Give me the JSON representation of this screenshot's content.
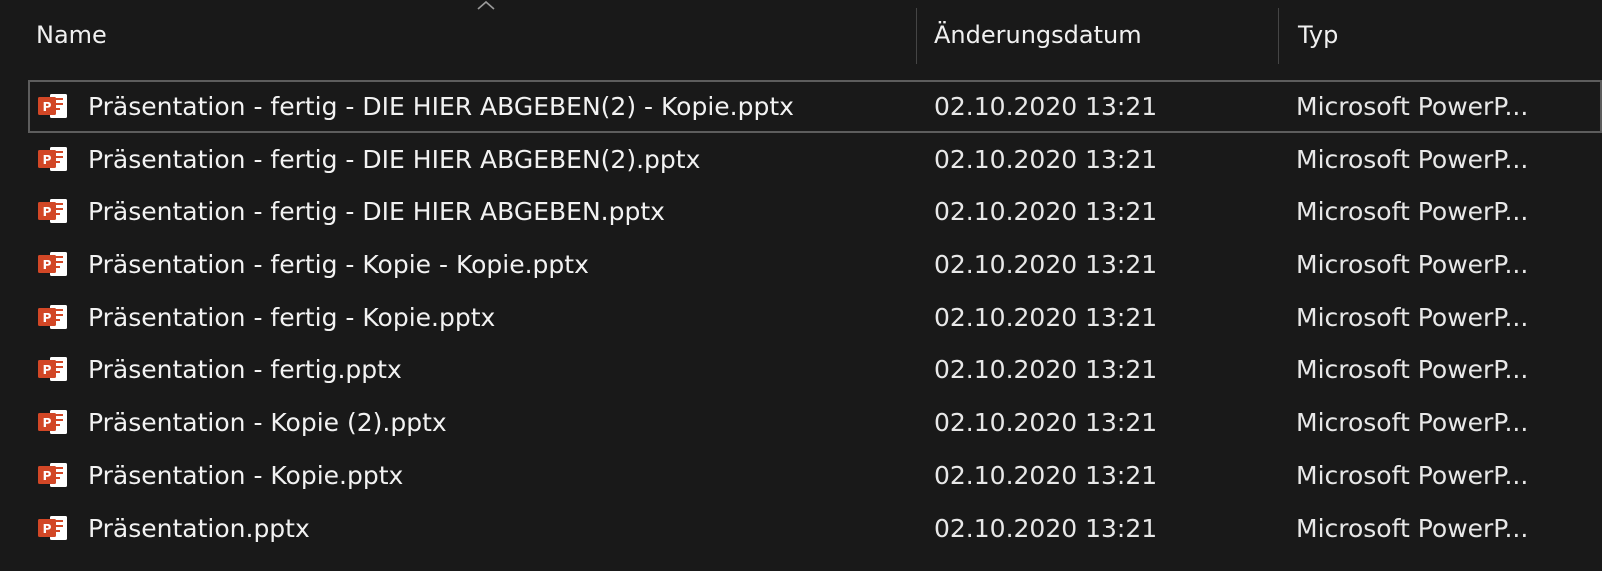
{
  "columns": {
    "name": "Name",
    "date": "Änderungsdatum",
    "type": "Typ"
  },
  "icons": {
    "sort": "chevron-up-icon",
    "file": "powerpoint-file-icon"
  },
  "colors": {
    "background": "#191919",
    "text": "#f2f2f2",
    "ppt_orange": "#d24726",
    "selection_border": "#5d5d5d"
  },
  "files": [
    {
      "name": "Präsentation - fertig - DIE HIER ABGEBEN(2) - Kopie.pptx",
      "date": "02.10.2020 13:21",
      "type": "Microsoft PowerP..."
    },
    {
      "name": "Präsentation - fertig - DIE HIER ABGEBEN(2).pptx",
      "date": "02.10.2020 13:21",
      "type": "Microsoft PowerP..."
    },
    {
      "name": "Präsentation - fertig - DIE HIER ABGEBEN.pptx",
      "date": "02.10.2020 13:21",
      "type": "Microsoft PowerP..."
    },
    {
      "name": "Präsentation - fertig - Kopie - Kopie.pptx",
      "date": "02.10.2020 13:21",
      "type": "Microsoft PowerP..."
    },
    {
      "name": "Präsentation - fertig - Kopie.pptx",
      "date": "02.10.2020 13:21",
      "type": "Microsoft PowerP..."
    },
    {
      "name": "Präsentation - fertig.pptx",
      "date": "02.10.2020 13:21",
      "type": "Microsoft PowerP..."
    },
    {
      "name": "Präsentation - Kopie (2).pptx",
      "date": "02.10.2020 13:21",
      "type": "Microsoft PowerP..."
    },
    {
      "name": "Präsentation - Kopie.pptx",
      "date": "02.10.2020 13:21",
      "type": "Microsoft PowerP..."
    },
    {
      "name": "Präsentation.pptx",
      "date": "02.10.2020 13:21",
      "type": "Microsoft PowerP..."
    }
  ]
}
